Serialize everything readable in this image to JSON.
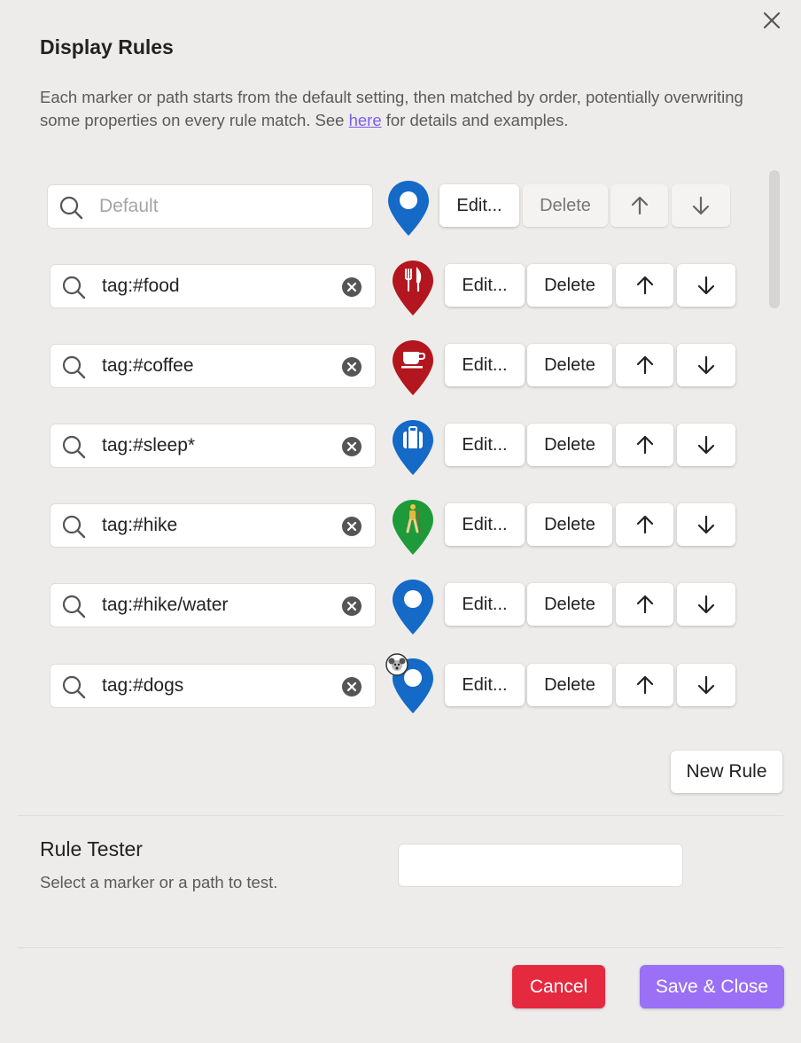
{
  "dialog": {
    "title": "Display Rules",
    "description_before": "Each marker or path starts from the default setting, then matched by order, potentially overwriting some properties on every rule match. See ",
    "description_link": "here",
    "description_after": " for details and examples.",
    "close_icon": "close-icon"
  },
  "buttons": {
    "edit": "Edit...",
    "delete": "Delete",
    "up_icon": "arrow-up-icon",
    "down_icon": "arrow-down-icon"
  },
  "rules": [
    {
      "query": "",
      "placeholder": "Default",
      "marker": "blue-plain",
      "color": "#1569c7",
      "is_default": true
    },
    {
      "query": "tag:#food",
      "marker": "fork-knife",
      "color": "#b3161e"
    },
    {
      "query": "tag:#coffee",
      "marker": "coffee-cup",
      "color": "#b3161e"
    },
    {
      "query": "tag:#sleep*",
      "marker": "luggage",
      "color": "#1569c7"
    },
    {
      "query": "tag:#hike",
      "marker": "hiker",
      "color": "#1f9a3a"
    },
    {
      "query": "tag:#hike/water",
      "marker": "blue-plain",
      "color": "#1569c7"
    },
    {
      "query": "tag:#dogs",
      "marker": "dog-badge",
      "color": "#1569c7"
    }
  ],
  "new_rule_label": "New Rule",
  "tester": {
    "title": "Rule Tester",
    "description": "Select a marker or a path to test.",
    "input_value": ""
  },
  "footer": {
    "cancel_label": "Cancel",
    "save_label": "Save & Close",
    "cancel_color": "#e5293f",
    "save_color": "#9a70f6"
  }
}
